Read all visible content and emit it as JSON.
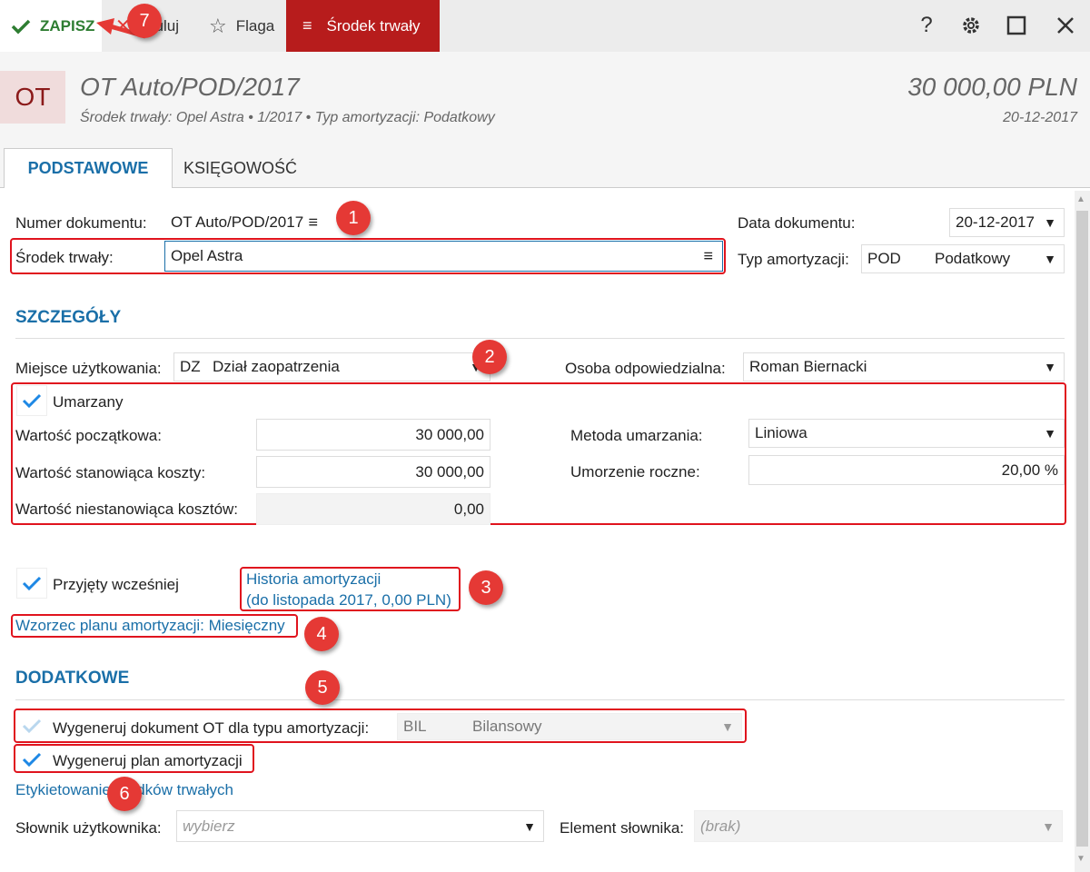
{
  "toolbar": {
    "save": "ZAPISZ",
    "cancel": "Anuluj",
    "flag": "Flaga",
    "fixed_asset": "Środek trwały",
    "help": "?",
    "colors": {
      "save": "#2e7d32",
      "active": "#b71c1c"
    }
  },
  "header": {
    "badge": "OT",
    "title": "OT Auto/POD/2017",
    "subtitle": "Środek trwały: Opel Astra  •  1/2017  •  Typ amortyzacji: Podatkowy",
    "amount": "30 000,00 PLN",
    "date": "20-12-2017"
  },
  "tabs": {
    "basic": "PODSTAWOWE",
    "accounting": "KSIĘGOWOŚĆ"
  },
  "form": {
    "doc_number_label": "Numer dokumentu:",
    "doc_number": "OT Auto/POD/2017",
    "doc_date_label": "Data dokumentu:",
    "doc_date": "20-12-2017",
    "asset_label": "Środek trwały:",
    "asset": "Opel Astra",
    "amort_type_label": "Typ amortyzacji:",
    "amort_type_code": "POD",
    "amort_type_name": "Podatkowy"
  },
  "details": {
    "heading": "SZCZEGÓŁY",
    "place_label": "Miejsce użytkowania:",
    "place_code": "DZ",
    "place_name": "Dział zaopatrzenia",
    "person_label": "Osoba odpowiedzialna:",
    "person": "Roman Biernacki",
    "depreciated_label": "Umarzany",
    "initial_value_label": "Wartość początkowa:",
    "initial_value": "30 000,00",
    "cost_value_label": "Wartość stanowiąca koszty:",
    "cost_value": "30 000,00",
    "noncost_value_label": "Wartość niestanowiąca kosztów:",
    "noncost_value": "0,00",
    "method_label": "Metoda umarzania:",
    "method": "Liniowa",
    "annual_label": "Umorzenie roczne:",
    "annual": "20,00 %",
    "accepted_label": "Przyjęty wcześniej",
    "history_line1": "Historia amortyzacji",
    "history_line2": "(do listopada 2017, 0,00 PLN)",
    "template_link": "Wzorzec planu amortyzacji: Miesięczny"
  },
  "extra": {
    "heading": "DODATKOWE",
    "generate_ot_label": "Wygeneruj dokument OT dla typu amortyzacji:",
    "generate_ot_code": "BIL",
    "generate_ot_name": "Bilansowy",
    "generate_plan_label": "Wygeneruj plan amortyzacji",
    "labeling_link": "Etykietowanie środków trwałych",
    "dict_label": "Słownik użytkownika:",
    "dict_placeholder": "wybierz",
    "element_label": "Element słownika:",
    "element_placeholder": "(brak)"
  },
  "markers": [
    "1",
    "2",
    "3",
    "4",
    "5",
    "6",
    "7"
  ]
}
